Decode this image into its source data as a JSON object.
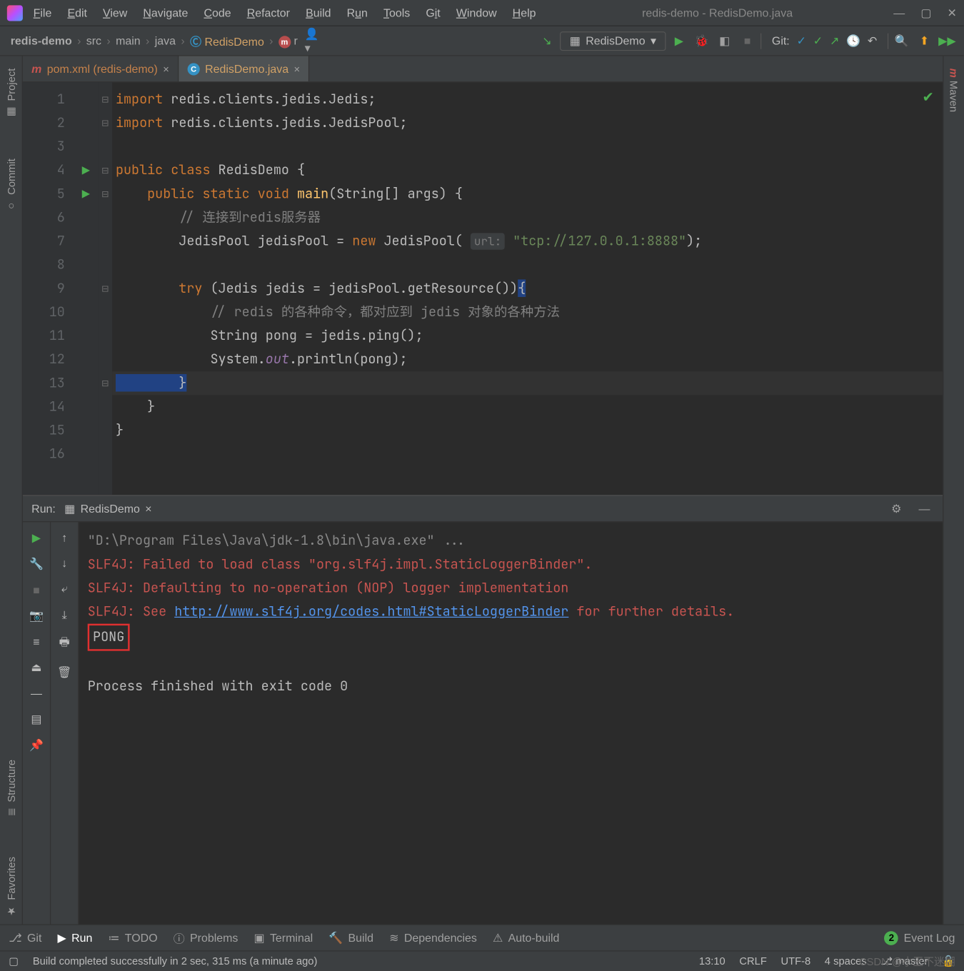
{
  "title": "redis-demo - RedisDemo.java",
  "menu": [
    "File",
    "Edit",
    "View",
    "Navigate",
    "Code",
    "Refactor",
    "Build",
    "Run",
    "Tools",
    "Git",
    "Window",
    "Help"
  ],
  "breadcrumbs": [
    "redis-demo",
    "src",
    "main",
    "java",
    "RedisDemo",
    "r"
  ],
  "breadcrumb_class_icon": "C",
  "breadcrumb_method_icon": "m",
  "run_config": "RedisDemo",
  "git_label": "Git:",
  "editor_tabs": [
    {
      "icon": "pom",
      "label": "pom.xml (redis-demo)",
      "active": false
    },
    {
      "icon": "java",
      "label": "RedisDemo.java",
      "active": true
    }
  ],
  "editor": {
    "line_numbers": [
      "1",
      "2",
      "3",
      "4",
      "5",
      "6",
      "7",
      "8",
      "9",
      "10",
      "11",
      "12",
      "13",
      "14",
      "15",
      "16"
    ],
    "gutter_icons": {
      "4": "run",
      "5": "run"
    },
    "fold_marks": {
      "1": "⊖",
      "2": "⊖",
      "4": "⊖",
      "5": "⊖",
      "9": "⊖",
      "13": "▭"
    },
    "lines": {
      "l1_kw": "import",
      "l1_rest": " redis.clients.jedis.Jedis;",
      "l2_kw": "import",
      "l2_rest": " redis.clients.jedis.JedisPool;",
      "l4_a": "public class ",
      "l4_b": "RedisDemo {",
      "l5_a": "    public static void ",
      "l5_fn": "main",
      "l5_b": "(String[] args) {",
      "l6_cmt": "        // 连接到redis服务器",
      "l7_a": "        JedisPool jedisPool = ",
      "l7_new": "new ",
      "l7_b": "JedisPool(",
      "l7_hint": "url:",
      "l7_str": " \"tcp://127.0.0.1:8888\"",
      "l7_c": ");",
      "l9_a": "        try ",
      "l9_b": "(Jedis jedis = jedisPool.getResource())",
      "l9_c": "{",
      "l10_cmt": "            // redis 的各种命令，都对应到 jedis 对象的各种方法",
      "l11": "            String pong = jedis.ping();",
      "l12_a": "            System.",
      "l12_out": "out",
      "l12_b": ".println(pong);",
      "l13": "        }",
      "l14": "    }",
      "l15": "}"
    }
  },
  "run_panel": {
    "title_label": "Run:",
    "tab": "RedisDemo",
    "console": {
      "cmd": "\"D:\\Program Files\\Java\\jdk-1.8\\bin\\java.exe\" ...",
      "e1": "SLF4J: Failed to load class \"org.slf4j.impl.StaticLoggerBinder\".",
      "e2": "SLF4J: Defaulting to no-operation (NOP) logger implementation",
      "e3a": "SLF4J: See ",
      "e3link": "http://www.slf4j.org/codes.html#StaticLoggerBinder",
      "e3b": " for further details.",
      "pong": "PONG",
      "exit": "Process finished with exit code 0"
    }
  },
  "left_tabs": [
    "Project",
    "Commit",
    "Structure",
    "Favorites"
  ],
  "right_tab": "Maven",
  "bottom_tabs": [
    "Git",
    "Run",
    "TODO",
    "Problems",
    "Terminal",
    "Build",
    "Dependencies",
    "Auto-build"
  ],
  "event_log": {
    "count": "2",
    "label": "Event Log"
  },
  "status": {
    "msg": "Build completed successfully in 2 sec, 315 ms (a minute ago)",
    "pos": "13:10",
    "eol": "CRLF",
    "enc": "UTF-8",
    "indent": "4 spaces",
    "branch": "master",
    "csdn": "CSDN @小王不迷糊"
  }
}
